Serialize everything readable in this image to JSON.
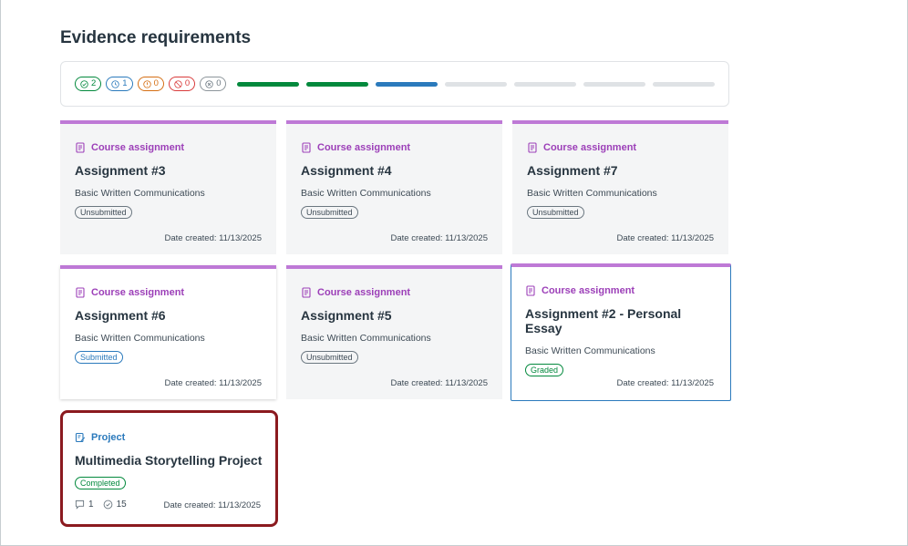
{
  "page_title": "Evidence requirements",
  "progress": {
    "pills": [
      {
        "icon": "check-circle-icon",
        "count": "2",
        "color": "#03893d"
      },
      {
        "icon": "clock-icon",
        "count": "1",
        "color": "#2b7abc"
      },
      {
        "icon": "warning-circle-icon",
        "count": "0",
        "color": "#d56f14"
      },
      {
        "icon": "no-circle-icon",
        "count": "0",
        "color": "#d93b3b"
      },
      {
        "icon": "x-circle-icon",
        "count": "0",
        "color": "#6b7780"
      }
    ],
    "segments": [
      "#03893d",
      "#03893d",
      "#2b7abc",
      "#dfe2e5",
      "#dfe2e5",
      "#dfe2e5",
      "#dfe2e5"
    ]
  },
  "cards": [
    {
      "type": "Course assignment",
      "title": "Assignment #3",
      "subtitle": "Basic Written Communications",
      "status": "Unsubmitted",
      "date": "Date created: 11/13/2025"
    },
    {
      "type": "Course assignment",
      "title": "Assignment #4",
      "subtitle": "Basic Written Communications",
      "status": "Unsubmitted",
      "date": "Date created: 11/13/2025"
    },
    {
      "type": "Course assignment",
      "title": "Assignment #7",
      "subtitle": "Basic Written Communications",
      "status": "Unsubmitted",
      "date": "Date created: 11/13/2025"
    },
    {
      "type": "Course assignment",
      "title": "Assignment #6",
      "subtitle": "Basic Written Communications",
      "status": "Submitted",
      "date": "Date created: 11/13/2025"
    },
    {
      "type": "Course assignment",
      "title": "Assignment #5",
      "subtitle": "Basic Written Communications",
      "status": "Unsubmitted",
      "date": "Date created: 11/13/2025"
    },
    {
      "type": "Course assignment",
      "title": "Assignment #2 - Personal Essay",
      "subtitle": "Basic Written Communications",
      "status": "Graded",
      "date": "Date created: 11/13/2025"
    }
  ],
  "project": {
    "type": "Project",
    "title": "Multimedia Storytelling Project",
    "status": "Completed",
    "comments": "1",
    "checks": "15",
    "date": "Date created: 11/13/2025"
  },
  "colors": {
    "assignment_accent": "#be79d6",
    "assignment_label": "#9c3fb8",
    "project_label": "#2b7abc",
    "selected_border": "#8b1a1f"
  }
}
